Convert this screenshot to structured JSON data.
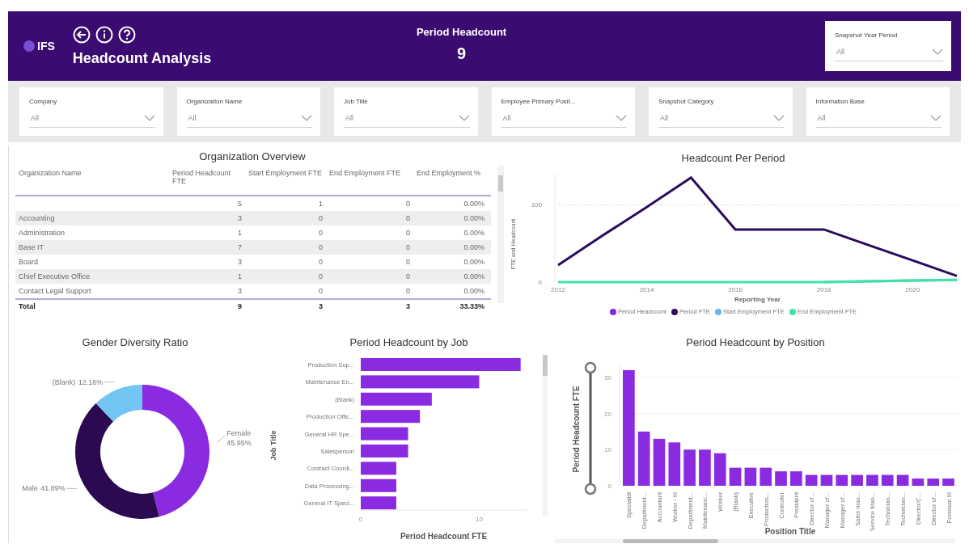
{
  "header": {
    "logo": "IFS",
    "title": "Headcount Analysis",
    "kpi": {
      "label": "Period Headcount",
      "value": "9"
    },
    "year_slicer": {
      "label": "Snapshot Year Period",
      "value": "All"
    }
  },
  "filters": [
    {
      "label": "Company",
      "value": "All"
    },
    {
      "label": "Organization Name",
      "value": "All"
    },
    {
      "label": "Job Title",
      "value": "All"
    },
    {
      "label": "Employee Primary Posit...",
      "value": "All"
    },
    {
      "label": "Snapshot Category",
      "value": "All"
    },
    {
      "label": "Information Base",
      "value": "All"
    }
  ],
  "org_overview": {
    "title": "Organization Overview",
    "columns": [
      "Organization Name",
      "Period Headcount FTE",
      "Start Employment FTE",
      "End Employment FTE",
      "End Employment %"
    ],
    "rows": [
      {
        "values": [
          "5",
          "1",
          "0",
          "0.00%"
        ]
      },
      {
        "name": "Accounting",
        "values": [
          "3",
          "0",
          "0",
          "0.00%"
        ]
      },
      {
        "name": "Administration",
        "values": [
          "1",
          "0",
          "0",
          "0.00%"
        ]
      },
      {
        "name": "Base IT",
        "values": [
          "7",
          "0",
          "0",
          "0.00%"
        ]
      },
      {
        "name": "Board",
        "values": [
          "3",
          "0",
          "0",
          "0.00%"
        ]
      },
      {
        "name": "Chief Executive Office",
        "values": [
          "1",
          "0",
          "0",
          "0.00%"
        ]
      },
      {
        "name": "Contact Legal Support",
        "values": [
          "3",
          "0",
          "0",
          "0.00%"
        ]
      }
    ],
    "total": {
      "label": "Total",
      "values": [
        "9",
        "3",
        "3",
        "33.33%"
      ]
    }
  },
  "headcount_per_period": {
    "title": "Headcount Per Period",
    "chart_data": {
      "type": "line",
      "xlabel": "Reporting Year",
      "ylabel": "FTE and Headcount",
      "x": [
        2012,
        2013,
        2014,
        2015,
        2016,
        2017,
        2018,
        2019,
        2020,
        2021
      ],
      "xlim": [
        2012,
        2021
      ],
      "xticks": [
        2012,
        2014,
        2016,
        2018,
        2020
      ],
      "yticks": [
        0,
        100
      ],
      "ylim": [
        0,
        140
      ],
      "grid": true,
      "series": [
        {
          "name": "Period Headcount",
          "color": "#7b2be2",
          "values": [
            null,
            null,
            null,
            null,
            null,
            null,
            null,
            null,
            null,
            null
          ]
        },
        {
          "name": "Period FTE",
          "color": "#2a0a5e",
          "values": [
            22,
            60,
            97,
            135,
            68,
            68,
            68,
            48,
            28,
            8
          ]
        },
        {
          "name": "Start Employment FTE",
          "color": "#6ab4e8",
          "values": [
            null,
            null,
            null,
            null,
            null,
            null,
            0,
            1,
            2,
            3
          ]
        },
        {
          "name": "End Employment FTE",
          "color": "#3fe3a6",
          "values": [
            0,
            0,
            0,
            0,
            0,
            0,
            0,
            1,
            2,
            3
          ]
        }
      ]
    }
  },
  "gender_diversity": {
    "title": "Gender Diversity Ratio",
    "chart_data": {
      "type": "donut",
      "categories": [
        "Female",
        "Male",
        "(Blank)"
      ],
      "values": [
        45.95,
        41.89,
        12.16
      ],
      "value_labels": [
        "45.95%",
        "41.89%",
        "12.16%"
      ]
    }
  },
  "headcount_by_job": {
    "title": "Period Headcount by Job",
    "chart_data": {
      "type": "bar",
      "orientation": "horizontal",
      "xlabel": "Period Headcount FTE",
      "ylabel": "Job Title",
      "categories": [
        "Production Sup...",
        "Maintenance En...",
        "(Blank)",
        "Production Offic...",
        "General HR Spe...",
        "Salesperson",
        "Contract Coordi...",
        "Data Processing...",
        "General IT Speci..."
      ],
      "values": [
        13.5,
        10,
        6,
        5,
        4,
        4,
        3,
        3,
        3
      ],
      "xlim": [
        0,
        14
      ],
      "xticks": [
        0,
        10
      ]
    }
  },
  "headcount_by_position": {
    "title": "Period Headcount by Position",
    "chart_data": {
      "type": "bar",
      "xlabel": "Position Title",
      "ylabel": "Period Headcount FTE",
      "categories": [
        "Specialist",
        "Department...",
        "Accountant",
        "Worker - III",
        "Department...",
        "Maintenanc...",
        "Worker",
        "(Blank)",
        "Executive",
        "Production...",
        "Controller",
        "President",
        "Director of...",
        "Manager of...",
        "Manager of...",
        "Sales man...",
        "Service Man...",
        "Technician...",
        "Technician...",
        "Director/C...",
        "Director of...",
        "Foreman III"
      ],
      "values": [
        32,
        15,
        13,
        12,
        10,
        10,
        9,
        5,
        5,
        5,
        4,
        4,
        3,
        3,
        3,
        3,
        3,
        3,
        3,
        2,
        2,
        2
      ],
      "yticks": [
        0,
        10,
        20,
        30
      ],
      "ylim": [
        0,
        34
      ],
      "grid": true
    }
  }
}
